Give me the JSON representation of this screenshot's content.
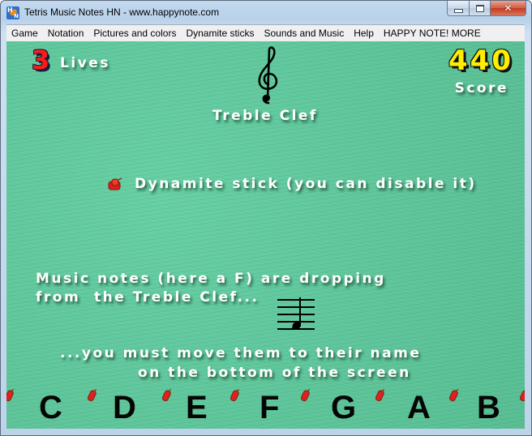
{
  "window": {
    "title": "Tetris Music Notes HN - www.happynote.com",
    "icon": "happynote-app-icon",
    "controls": {
      "minimize": "minimize-icon",
      "maximize": "maximize-icon",
      "close_glyph": "✕"
    }
  },
  "menu": {
    "items": [
      {
        "label": "Game"
      },
      {
        "label": "Notation"
      },
      {
        "label": "Pictures and colors"
      },
      {
        "label": "Dynamite sticks"
      },
      {
        "label": "Sounds and Music"
      },
      {
        "label": "Help"
      },
      {
        "label": "HAPPY NOTE! MORE"
      }
    ]
  },
  "game": {
    "lives": {
      "count": "3",
      "label": "Lives"
    },
    "score": {
      "value": "440",
      "label": "Score"
    },
    "clef": {
      "icon": "treble-clef-icon",
      "label": "Treble Clef"
    },
    "dynamite": {
      "icon": "dynamite-stick-icon",
      "text": "Dynamite stick (you can disable it)"
    },
    "instructions": {
      "line1": "Music notes (here a F) are dropping",
      "line2": "from  the Treble Clef...",
      "line3": "...you must move them to their name",
      "line4": "on the bottom of the screen"
    },
    "falling_note": {
      "name": "F",
      "icon": "note-on-staff-icon"
    },
    "note_names": [
      "C",
      "D",
      "E",
      "F",
      "G",
      "A",
      "B"
    ],
    "colors": {
      "background": "#5ec79b",
      "lives_number": "#ff1a1a",
      "score_number": "#ffee00",
      "text": "#ffffff"
    }
  }
}
